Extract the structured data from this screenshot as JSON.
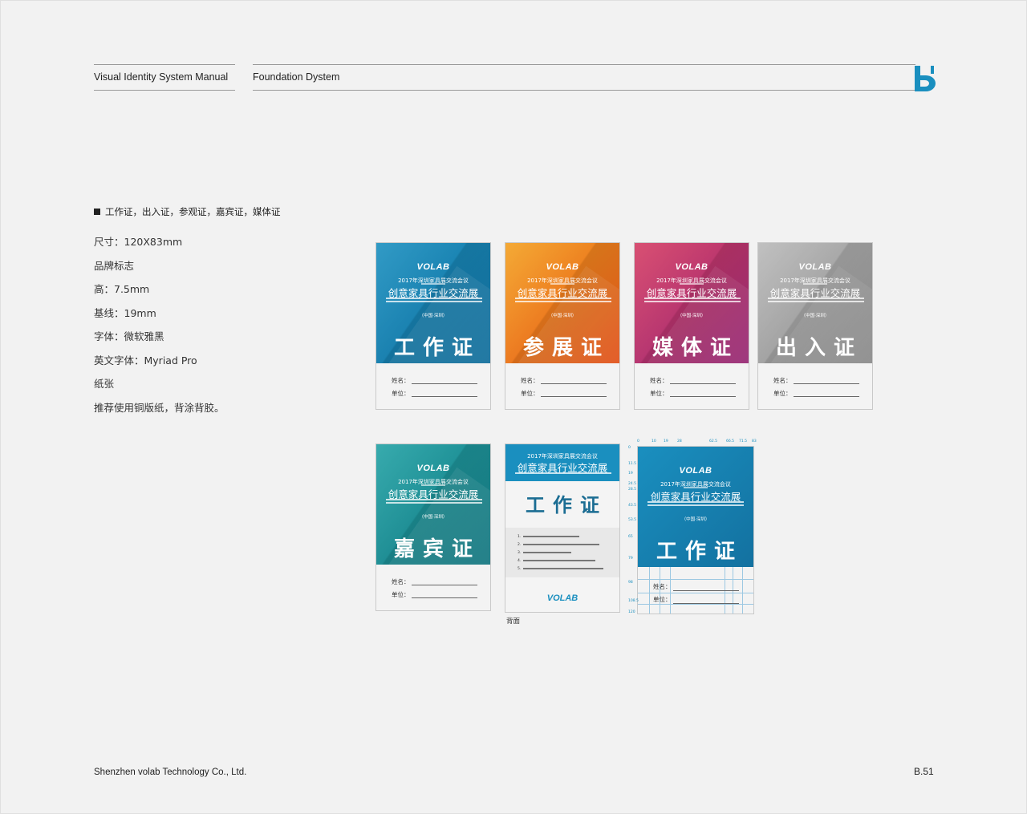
{
  "header": {
    "manual_title": "Visual Identity System Manual",
    "section_title": "Foundation Dystem",
    "logo_letter": "b",
    "accent_color": "#1a8fbf"
  },
  "section": {
    "title": "工作证，出入证，参观证，嘉宾证，媒体证",
    "specs": [
      "尺寸：120X83mm",
      "品牌标志",
      "高：7.5mm",
      "基线：19mm",
      "字体：微软雅黑",
      "英文字体：Myriad Pro",
      "纸张",
      "推荐使用铜版纸，背涂背胶。"
    ]
  },
  "badge_common": {
    "brand": "VOLAB",
    "event_year_line": "2017年深圳家具展交流会议",
    "event_title": "创意家具行业交流展",
    "location": "（中国·深圳）",
    "name_label": "姓名：",
    "unit_label": "单位："
  },
  "badges": [
    {
      "label": "工作证",
      "color_a": "#1a8fbf",
      "color_b": "#1371a0"
    },
    {
      "label": "参展证",
      "color_a": "#f3a01f",
      "color_b": "#e6531a"
    },
    {
      "label": "媒体证",
      "color_a": "#d43c63",
      "color_b": "#9a2a78"
    },
    {
      "label": "出入证",
      "color_a": "#b9b9b9",
      "color_b": "#8d8d8d"
    },
    {
      "label": "嘉宾证",
      "color_a": "#21a1a4",
      "color_b": "#167a84"
    }
  ],
  "back_card": {
    "event_year_line": "2017年深圳家具展交流会议",
    "event_title": "创意家具行业交流展",
    "label": "工作证",
    "notes": [
      "1.",
      "2.",
      "3.",
      "4.",
      "5."
    ],
    "brand": "VOLAB",
    "caption": "背面"
  },
  "dim_card": {
    "label": "工作证",
    "top_ticks": [
      "0",
      "10",
      "19",
      "28",
      "62.5",
      "66.5",
      "71.5",
      "83"
    ],
    "left_ticks": [
      "0",
      "11.5",
      "19",
      "24.5",
      "28.5",
      "43.5",
      "53.5",
      "65",
      "79",
      "98",
      "108.5",
      "120"
    ]
  },
  "footer": {
    "company": "Shenzhen volab Technology Co., Ltd.",
    "page_number": "B.51"
  }
}
